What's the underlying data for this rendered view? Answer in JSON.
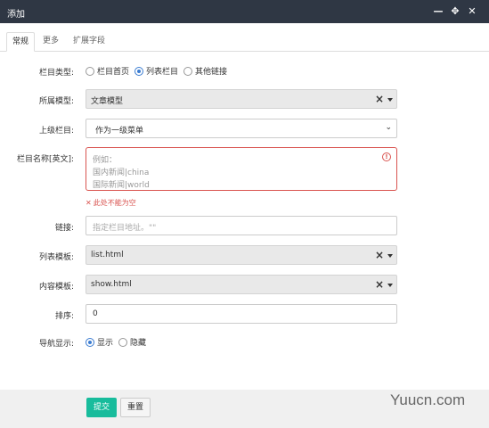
{
  "window": {
    "title": "添加",
    "controls": [
      "—",
      "✥",
      "✕"
    ]
  },
  "tabs": [
    {
      "label": "常规"
    },
    {
      "label": "更多"
    },
    {
      "label": "扩展字段"
    }
  ],
  "form": {
    "column_type": {
      "label": "栏目类型:",
      "options": [
        "栏目首页",
        "列表栏目",
        "其他链接"
      ],
      "selected": "列表栏目"
    },
    "model": {
      "label": "所属模型:",
      "value": "文章模型"
    },
    "parent": {
      "label": "上级栏目:",
      "value": "作为一级菜单"
    },
    "name_en": {
      "label": "栏目名称[英文]:",
      "placeholder_lines": [
        "例如：",
        "国内新闻|china",
        "国际新闻|world"
      ],
      "error": "此处不能为空"
    },
    "link": {
      "label": "链接:",
      "placeholder": "指定栏目地址。\"\""
    },
    "list_template": {
      "label": "列表模板:",
      "value": "list.html"
    },
    "content_template": {
      "label": "内容模板:",
      "value": "show.html"
    },
    "sort": {
      "label": "排序:",
      "value": "0"
    },
    "nav_display": {
      "label": "导航显示:",
      "options": [
        "显示",
        "隐藏"
      ],
      "selected": "显示"
    }
  },
  "buttons": {
    "submit": "提交",
    "reset": "重置"
  },
  "watermark": "Yuucn.com",
  "colors": {
    "titlebar": "#2f3744",
    "submit": "#18bc9c",
    "error": "#d9534f"
  }
}
